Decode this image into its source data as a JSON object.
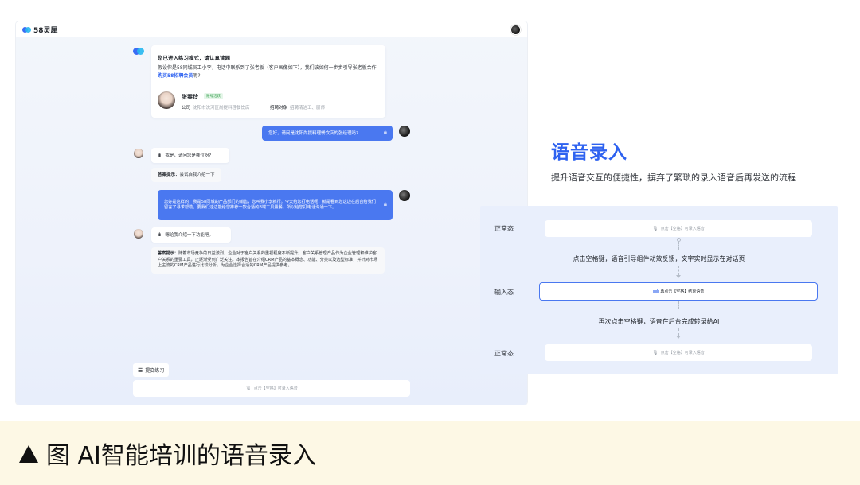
{
  "app": {
    "logo_text": "58灵犀",
    "intro": {
      "title": "您已进入练习模式，请认真读题",
      "text_before": "假设你是58同城员工小李，电话中联系到了张老板（客户画像如下），我们该如何一步步引导张老板合作",
      "text_link": "购买58招聘会员",
      "text_after": "呢?"
    },
    "profile": {
      "name": "张春玲",
      "tag": "账号活跃",
      "company_label": "公司",
      "company_value": "沈阳市沈河区尚提料理餐饮店",
      "recruit_label": "招聘对象",
      "recruit_value": "招聘清洁工、厨师"
    },
    "messages": {
      "user1": "您好，请问是沈阳尚提料理餐饮店的张经理吗?",
      "bot1": "我是，请问您是哪位呀?",
      "hint1_label": "答案提示：",
      "hint1_text": "尝试自我介绍一下",
      "user2": "您好是这样的，我是58同城的产品部门的销售，您叫我小李就行。今天给您打电话呢，就是看到您这边在后台给我们留言了寻求帮助，要我们这边能给您推荐一款合适的B端工具量餐，所以给您打电话沟通一下。",
      "bot2": "嗯给我介绍一下功能吧。",
      "hint2_label": "答案提示：",
      "hint2_text": "随着市场竞争的日益激烈，企业对于客户关系的重视程度不断提升。客户关系管理产品作为企业管理和维护客户关系的重要工具，正逐渐受到广泛关注。本报告旨在介绍CRM产品的基本概念、功能、分类以及选型标准，并针对市场上主流的CRM产品进行比较分析，为企业选择合适的CRM产品提供参考。"
    },
    "submit_label": "提交练习",
    "input_hint": "点击【空格】可录入语音"
  },
  "right": {
    "title": "语音录入",
    "subtitle": "提升语音交互的便捷性，摒弃了繁琐的录入语音后再发送的流程",
    "flow": {
      "state1_label": "正常态",
      "state1_hint": "点击【空格】可录入语音",
      "step1": "点击空格键，语音引导组件动效反馈，文字实时显示在对话页",
      "state2_label": "输入态",
      "state2_hint": "再点击【空格】结束语音",
      "step2": "再次点击空格键，语音在后台完成转录给AI",
      "state3_label": "正常态",
      "state3_hint": "点击【空格】可录入语音"
    }
  },
  "caption": {
    "text": "图 AI智能培训的语音录入"
  },
  "colors": {
    "accent": "#2e62f0",
    "bubble": "#4a78f0",
    "panel": "#e9effc",
    "caption_bg": "#fdf8e5"
  }
}
